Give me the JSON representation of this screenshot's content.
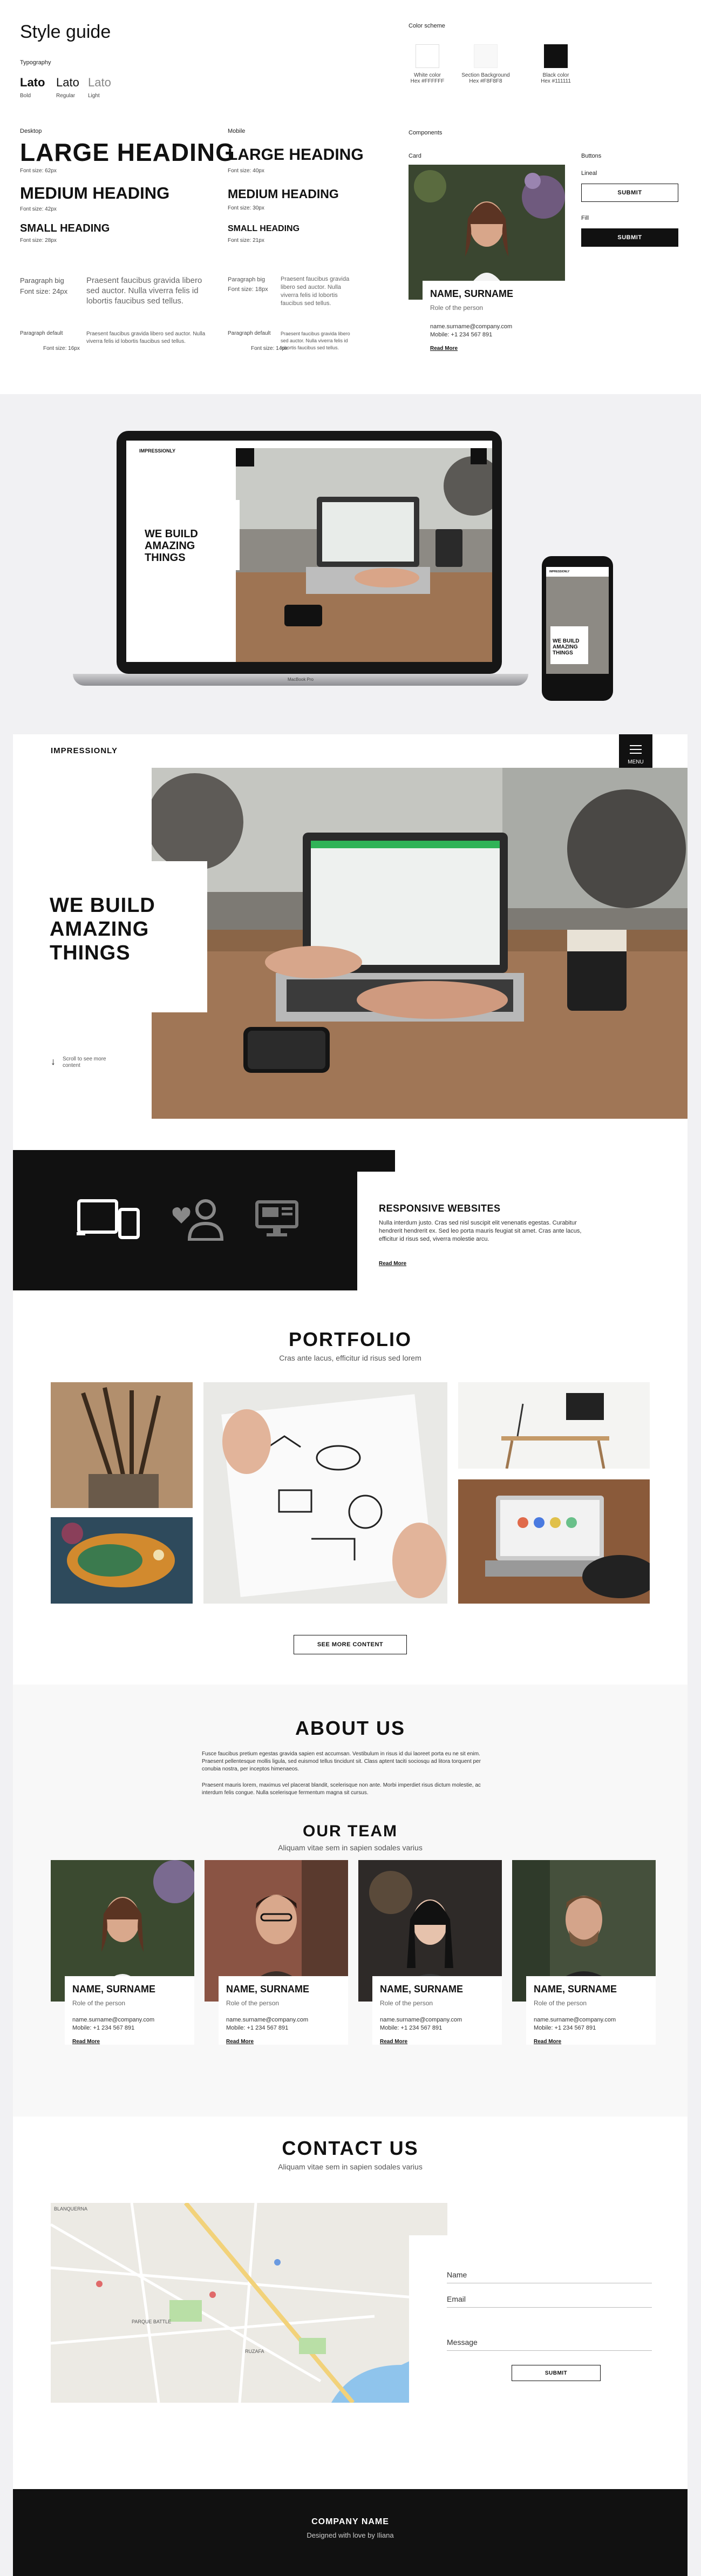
{
  "style_guide": {
    "title": "Style guide",
    "typography_label": "Typography",
    "fonts": [
      {
        "name": "Lato",
        "weight": "Bold"
      },
      {
        "name": "Lato",
        "weight": "Regular"
      },
      {
        "name": "Lato",
        "weight": "Light"
      }
    ],
    "color_scheme_label": "Color scheme",
    "colors": [
      {
        "label": "White color",
        "hex": "Hex #FFFFFF",
        "value": "#ffffff"
      },
      {
        "label": "Section Background",
        "hex": "Hex #F8F8F8",
        "value": "#f8f8f8"
      },
      {
        "label": "Black color",
        "hex": "Hex #111111",
        "value": "#111111"
      }
    ],
    "desktop_label": "Desktop",
    "mobile_label": "Mobile",
    "desktop": {
      "large": "LARGE HEADING",
      "large_size": "Font size: 62px",
      "medium": "MEDIUM HEADING",
      "medium_size": "Font size: 42px",
      "small": "SMALL HEADING",
      "small_size": "Font size: 28px",
      "p_big_label": "Paragraph big",
      "p_big_size": "Font size: 24px",
      "p_big_text": "Praesent faucibus gravida libero sed auctor. Nulla viverra felis id lobortis faucibus sed tellus.",
      "p_default_label": "Paragraph default",
      "p_default_size": "Font size: 16px",
      "p_default_text": "Praesent faucibus gravida libero sed auctor. Nulla viverra felis id lobortis faucibus sed tellus."
    },
    "mobile": {
      "large": "LARGE HEADING",
      "large_size": "Font size: 40px",
      "medium": "MEDIUM HEADING",
      "medium_size": "Font size: 30px",
      "small": "SMALL HEADING",
      "small_size": "Font size: 21px",
      "p_big_label": "Paragraph big",
      "p_big_size": "Font size: 18px",
      "p_big_text": "Praesent faucibus gravida libero sed auctor. Nulla viverra felis id lobortis faucibus sed tellus.",
      "p_default_label": "Paragraph default",
      "p_default_size": "Font size: 14px",
      "p_default_text": "Praesent faucibus gravida libero sed auctor. Nulla viverra felis id lobortis faucibus sed tellus."
    },
    "components_label": "Components",
    "card_label": "Card",
    "card": {
      "name": "NAME, SURNAME",
      "role": "Role of the person",
      "email": "name.surname@company.com",
      "mobile": "Mobile: +1 234 567 891",
      "read_more": "Read More"
    },
    "buttons_label": "Buttons",
    "lineal_label": "Lineal",
    "fill_label": "Fill",
    "submit_label": "SUBMIT"
  },
  "mockup": {
    "laptop_brand": "IMPRESSIONLY",
    "laptop_hero": "WE BUILD AMAZING THINGS",
    "laptop_label": "MacBook Pro",
    "phone_hero": "WE BUILD AMAZING THINGS",
    "phone_brand": "IMPRESSIONLY"
  },
  "site": {
    "brand": "IMPRESSIONLY",
    "menu_label": "MENU",
    "hero_title": "WE BUILD AMAZING THINGS",
    "scroll_hint": "Scroll to see more content",
    "services": {
      "title": "RESPONSIVE WEBSITES",
      "text": "Nulla interdum justo. Cras sed nisl suscipit elit venenatis egestas. Curabitur hendrerit hendrerit ex. Sed leo porta mauris feugiat sit amet. Cras ante lacus, efficitur id risus sed, viverra molestie arcu.",
      "read_more": "Read More"
    },
    "portfolio": {
      "title": "PORTFOLIO",
      "subtitle": "Cras ante lacus, efficitur id risus sed lorem",
      "button": "SEE MORE CONTENT"
    },
    "about": {
      "title": "ABOUT US",
      "p1": "Fusce faucibus pretium egestas gravida sapien est accumsan. Vestibulum in risus id dui laoreet porta eu ne sit enim. Praesent pellentesque mollis ligula, sed euismod tellus tincidunt sit. Class aptent taciti sociosqu ad litora torquent per conubia nostra, per inceptos himenaeos.",
      "p2": "Praesent mauris lorem, maximus vel placerat blandit, scelerisque non ante. Morbi imperdiet risus dictum molestie, ac interdum felis congue. Nulla scelerisque fermentum magna sit cursus."
    },
    "team": {
      "title": "OUR TEAM",
      "subtitle": "Aliquam vitae sem in sapien sodales varius",
      "members": [
        {
          "name": "NAME, SURNAME",
          "role": "Role of the person",
          "email": "name.surname@company.com",
          "mobile": "Mobile: +1 234 567 891",
          "read_more": "Read More"
        },
        {
          "name": "NAME, SURNAME",
          "role": "Role of the person",
          "email": "name.surname@company.com",
          "mobile": "Mobile: +1 234 567 891",
          "read_more": "Read More"
        },
        {
          "name": "NAME, SURNAME",
          "role": "Role of the person",
          "email": "name.surname@company.com",
          "mobile": "Mobile: +1 234 567 891",
          "read_more": "Read More"
        },
        {
          "name": "NAME, SURNAME",
          "role": "Role of the person",
          "email": "name.surname@company.com",
          "mobile": "Mobile: +1 234 567 891",
          "read_more": "Read More"
        }
      ]
    },
    "contact": {
      "title": "CONTACT US",
      "subtitle": "Aliquam vitae sem in sapien sodales varius",
      "name_label": "Name",
      "email_label": "Email",
      "message_label": "Message",
      "submit": "SUBMIT",
      "map_labels": [
        "BLANQUERNA",
        "PARQUE BATTLE",
        "RUZAFA"
      ]
    },
    "footer": {
      "company": "COMPANY NAME",
      "credit": "Designed with love by Iliana"
    }
  }
}
